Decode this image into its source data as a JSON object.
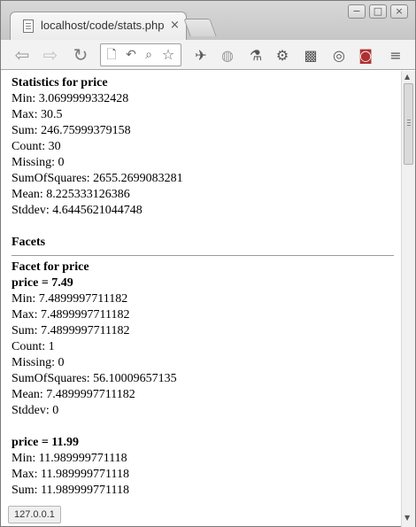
{
  "browser": {
    "tab_title": "localhost/code/stats.php",
    "tab_close": "×",
    "window_controls": {
      "minimize": "−",
      "maximize": "□",
      "close": "×"
    },
    "nav": {
      "back": "⇦",
      "forward": "⇨",
      "reload": "↻"
    },
    "omnibox_icons": {
      "page": "🗋",
      "undo": "↶",
      "zoom": "⌕",
      "star": "☆"
    },
    "extension_glyphs": [
      "✈",
      "◍",
      "⚗",
      "⚙",
      "▩",
      "◎",
      "◙"
    ],
    "menu": "≡",
    "status_text": "127.0.0.1"
  },
  "page": {
    "stats_heading": "Statistics for price",
    "stats": [
      "Min: 3.0699999332428",
      "Max: 30.5",
      "Sum: 246.75999379158",
      "Count: 30",
      "Missing: 0",
      "SumOfSquares: 2655.2699083281",
      "Mean: 8.225333126386",
      "Stddev: 4.6445621044748"
    ],
    "facets_heading": "Facets",
    "facet_heading": "Facet for price",
    "facet_749": {
      "title": "price = 7.49",
      "lines": [
        "Min: 7.4899997711182",
        "Max: 7.4899997711182",
        "Sum: 7.4899997711182",
        "Count: 1",
        "Missing: 0",
        "SumOfSquares: 56.10009657135",
        "Mean: 7.4899997711182",
        "Stddev: 0"
      ]
    },
    "facet_1199": {
      "title": "price = 11.99",
      "lines": [
        "Min: 11.989999771118",
        "Max: 11.989999771118",
        "Sum: 11.989999771118"
      ]
    }
  }
}
